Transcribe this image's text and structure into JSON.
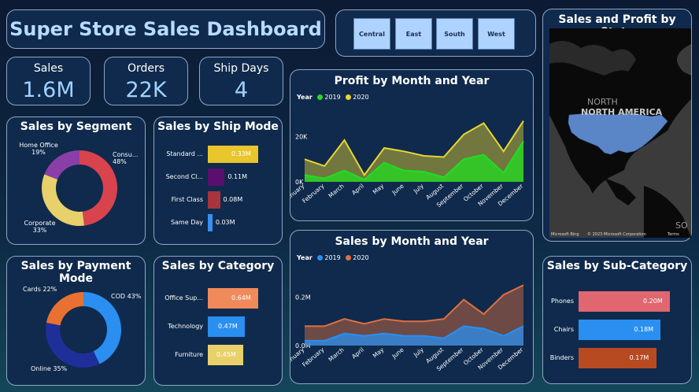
{
  "header": {
    "title": "Super Store Sales Dashboard"
  },
  "filters": {
    "regions": [
      "Central",
      "East",
      "South",
      "West"
    ]
  },
  "kpis": [
    {
      "label": "Sales",
      "value": "1.6M"
    },
    {
      "label": "Orders",
      "value": "22K"
    },
    {
      "label": "Ship Days",
      "value": "4"
    }
  ],
  "colors": {
    "y2019_profit": "#22dd22",
    "y2020_profit": "#e8d530",
    "y2019_sales": "#2a8ff0",
    "y2020_sales": "#e07040"
  },
  "segment": {
    "title": "Sales by Segment",
    "labels": {
      "consumer": "Consu...",
      "consumer_pct": "48%",
      "home": "Home Office",
      "home_pct": "19%",
      "corporate": "Corporate",
      "corporate_pct": "33%"
    }
  },
  "ship_mode": {
    "title": "Sales by Ship Mode"
  },
  "payment": {
    "title": "Sales by Payment Mode",
    "labels": {
      "cards": "Cards 22%",
      "cod": "COD 43%",
      "online": "Online 35%"
    }
  },
  "category": {
    "title": "Sales by Category"
  },
  "profit_chart": {
    "title": "Profit by Month and Year",
    "legend_title": "Year",
    "legend": [
      "2019",
      "2020"
    ]
  },
  "sales_chart": {
    "title": "Sales by Month and Year",
    "legend_title": "Year",
    "legend": [
      "2019",
      "2020"
    ]
  },
  "map": {
    "title": "Sales and Profit by State",
    "label": "NORTH AMERICA",
    "label_ne": "NORTH",
    "label_s": "SO",
    "credit_bing": "Microsoft Bing",
    "credit": "© 2023 Microsoft Corporation",
    "credit_terms": "Terms"
  },
  "subcategory": {
    "title": "Sales by Sub-Category"
  },
  "chart_data": [
    {
      "type": "pie",
      "title": "Sales by Segment",
      "categories": [
        "Consumer",
        "Corporate",
        "Home Office"
      ],
      "values": [
        48,
        33,
        19
      ],
      "colors": [
        "#d9434e",
        "#e8d06a",
        "#8b3ea8"
      ]
    },
    {
      "type": "bar",
      "title": "Sales by Ship Mode",
      "categories": [
        "Standard ...",
        "Second Cl...",
        "First Class",
        "Same Day"
      ],
      "values": [
        0.33,
        0.11,
        0.08,
        0.03
      ],
      "labels": [
        "0.33M",
        "0.11M",
        "0.08M",
        "0.03M"
      ],
      "colors": [
        "#e8c62c",
        "#5a0f6e",
        "#a8343e",
        "#3a8ff0"
      ]
    },
    {
      "type": "pie",
      "title": "Sales by Payment Mode",
      "categories": [
        "COD",
        "Online",
        "Cards"
      ],
      "values": [
        43,
        35,
        22
      ],
      "colors": [
        "#2a8ff0",
        "#1f2f9a",
        "#e87030"
      ]
    },
    {
      "type": "bar",
      "title": "Sales by Category",
      "categories": [
        "Office Sup...",
        "Technology",
        "Furniture"
      ],
      "values": [
        0.64,
        0.47,
        0.45
      ],
      "labels": [
        "0.64M",
        "0.47M",
        "0.45M"
      ],
      "colors": [
        "#f08a5a",
        "#2a8ff0",
        "#e8d06a"
      ]
    },
    {
      "type": "area",
      "title": "Profit by Month and Year",
      "categories": [
        "January",
        "February",
        "March",
        "April",
        "May",
        "June",
        "July",
        "August",
        "September",
        "October",
        "November",
        "December"
      ],
      "yticks": [
        "0K",
        "20K"
      ],
      "ylim": [
        0,
        30000
      ],
      "series": [
        {
          "name": "2019",
          "values": [
            3000,
            1500,
            5000,
            1000,
            8500,
            5000,
            4500,
            2000,
            10000,
            12000,
            4000,
            18000
          ]
        },
        {
          "name": "2020",
          "values": [
            10000,
            7000,
            18500,
            3000,
            15000,
            13500,
            11500,
            11000,
            21000,
            26000,
            13500,
            27000
          ]
        }
      ]
    },
    {
      "type": "area",
      "title": "Sales by Month and Year",
      "categories": [
        "January",
        "February",
        "March",
        "April",
        "May",
        "June",
        "July",
        "August",
        "September",
        "October",
        "November",
        "December"
      ],
      "yticks": [
        "0.0M",
        "0.2M"
      ],
      "ylim": [
        0,
        0.28
      ],
      "series": [
        {
          "name": "2019",
          "values": [
            0.02,
            0.02,
            0.05,
            0.04,
            0.05,
            0.04,
            0.04,
            0.03,
            0.08,
            0.07,
            0.04,
            0.08
          ]
        },
        {
          "name": "2020",
          "values": [
            0.08,
            0.08,
            0.11,
            0.09,
            0.11,
            0.1,
            0.1,
            0.11,
            0.19,
            0.13,
            0.21,
            0.25
          ]
        }
      ]
    },
    {
      "type": "bar",
      "title": "Sales by Sub-Category",
      "categories": [
        "Phones",
        "Chairs",
        "Binders"
      ],
      "values": [
        0.2,
        0.18,
        0.17
      ],
      "labels": [
        "0.20M",
        "0.18M",
        "0.17M"
      ],
      "colors": [
        "#e06670",
        "#2a8ff0",
        "#b84a22"
      ]
    }
  ]
}
